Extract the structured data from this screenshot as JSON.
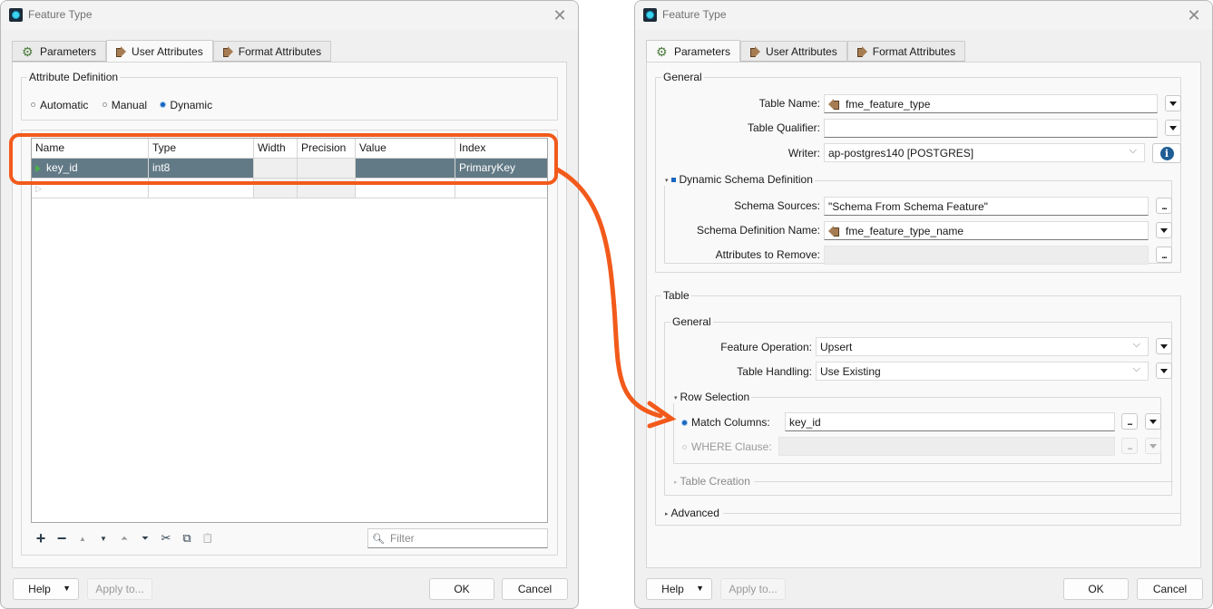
{
  "left_dialog": {
    "title": "Feature Type",
    "tabs": [
      {
        "label": "Parameters",
        "icon": "gear-icon",
        "active": false
      },
      {
        "label": "User Attributes",
        "icon": "feature-arrow-icon",
        "active": true
      },
      {
        "label": "Format Attributes",
        "icon": "feature-arrow-icon",
        "active": false
      }
    ],
    "attribute_definition": {
      "title": "Attribute Definition",
      "options": [
        "Automatic",
        "Manual",
        "Dynamic"
      ],
      "selected": "Dynamic"
    },
    "table": {
      "columns": [
        "Name",
        "Type",
        "Width",
        "Precision",
        "Value",
        "Index"
      ],
      "rows": [
        {
          "name": "key_id",
          "type": "int8",
          "width": "",
          "precision": "",
          "value": "",
          "index": "PrimaryKey"
        }
      ]
    },
    "toolbar": {
      "actions": [
        "add",
        "remove",
        "move-up",
        "move-down",
        "move-to-top",
        "move-to-bottom",
        "cut",
        "copy",
        "paste"
      ],
      "add_glyph": "+",
      "remove_glyph": "−",
      "up_glyph": "▲",
      "down_glyph": "▼",
      "top_glyph": "⏶",
      "bottom_glyph": "⏷",
      "cut_glyph": "✂",
      "copy_glyph": "⧉",
      "paste_glyph": "📋"
    },
    "filter_placeholder": "Filter",
    "buttons": {
      "help": "Help",
      "apply_to": "Apply to...",
      "ok": "OK",
      "cancel": "Cancel"
    }
  },
  "right_dialog": {
    "title": "Feature Type",
    "tabs": [
      {
        "label": "Parameters",
        "icon": "gear-icon",
        "active": true
      },
      {
        "label": "User Attributes",
        "icon": "feature-arrow-icon",
        "active": false
      },
      {
        "label": "Format Attributes",
        "icon": "feature-arrow-icon",
        "active": false
      }
    ],
    "general": {
      "title": "General",
      "table_name_label": "Table Name:",
      "table_name_value": "fme_feature_type",
      "table_qualifier_label": "Table Qualifier:",
      "table_qualifier_value": "",
      "writer_label": "Writer:",
      "writer_value": "ap-postgres140 [POSTGRES]",
      "dynamic_schema": {
        "title": "Dynamic Schema Definition",
        "schema_sources_label": "Schema Sources:",
        "schema_sources_value": "\"Schema From Schema Feature\"",
        "schema_def_name_label": "Schema Definition Name:",
        "schema_def_name_value": "fme_feature_type_name",
        "attrs_remove_label": "Attributes to Remove:",
        "attrs_remove_value": ""
      }
    },
    "table_section": {
      "title": "Table",
      "general_title": "General",
      "feature_operation_label": "Feature Operation:",
      "feature_operation_value": "Upsert",
      "table_handling_label": "Table Handling:",
      "table_handling_value": "Use Existing",
      "row_selection": {
        "title": "Row Selection",
        "match_columns_label": "Match Columns:",
        "match_columns_value": "key_id",
        "where_clause_label": "WHERE Clause:",
        "where_clause_value": "",
        "selected": "Match Columns"
      },
      "table_creation_title": "Table Creation"
    },
    "advanced_title": "Advanced",
    "buttons": {
      "help": "Help",
      "apply_to": "Apply to...",
      "ok": "OK",
      "cancel": "Cancel"
    }
  },
  "annotation": {
    "highlight_color": "#f25a1b",
    "description": "Arrow from key_id PrimaryKey row to Match Columns"
  },
  "colors": {
    "selected_row": "#627a86",
    "radio_selected": "#1967c0",
    "info_icon": "#1f5e94"
  }
}
